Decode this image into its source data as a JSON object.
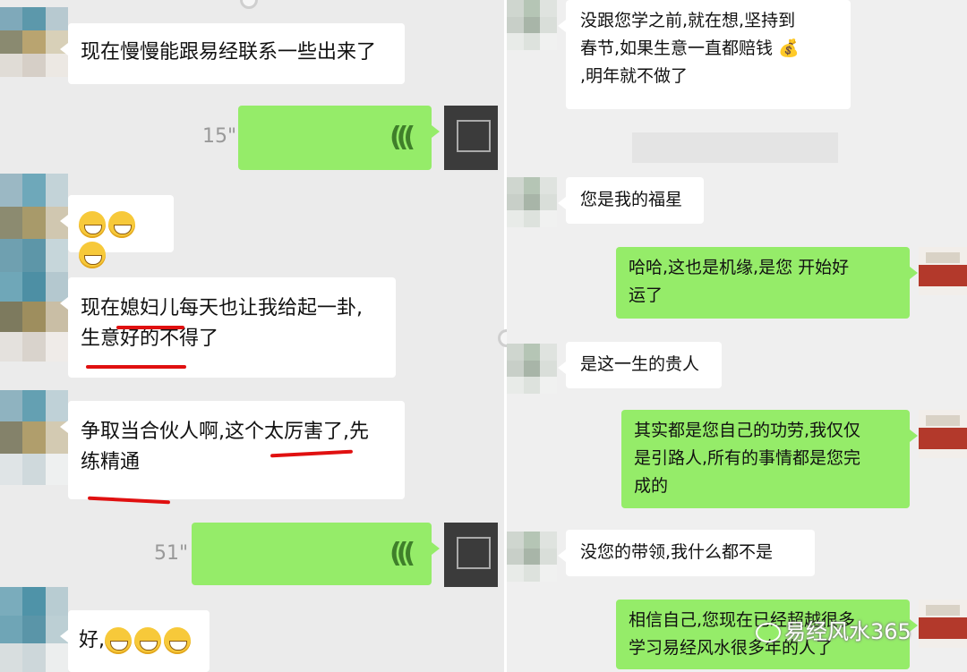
{
  "left": {
    "messages": [
      {
        "type": "text",
        "side": "in",
        "text": "现在慢慢能跟易经联系一些出来了"
      },
      {
        "type": "voice",
        "side": "out",
        "duration": "15\""
      },
      {
        "type": "emoji",
        "side": "in",
        "count": 3
      },
      {
        "type": "text",
        "side": "in",
        "line1": "现在媳妇儿每天也让我给起一卦,",
        "line2": "生意好的不得了"
      },
      {
        "type": "text",
        "side": "in",
        "line1": "争取当合伙人啊,这个太厉害了,先",
        "line2": "练精通"
      },
      {
        "type": "voice",
        "side": "out",
        "duration": "51\""
      },
      {
        "type": "emoji",
        "side": "in",
        "prefix": "好,",
        "count": 3
      }
    ],
    "voice_icon": "voice-wave-icon",
    "annotation_color": "#e01010"
  },
  "right": {
    "messages": [
      {
        "side": "in",
        "line1": "没跟您学之前,就在想,坚持到",
        "line2": "春节,如果生意一直都赔钱 💰",
        "line3": ",明年就不做了"
      },
      {
        "side": "in",
        "text": "您是我的福星"
      },
      {
        "side": "out",
        "line1": "哈哈,这也是机缘,是您 开始好",
        "line2": "运了"
      },
      {
        "side": "in",
        "text": "是这一生的贵人"
      },
      {
        "side": "out",
        "line1": "其实都是您自己的功劳,我仅仅",
        "line2": "是引路人,所有的事情都是您完",
        "line3": "成的"
      },
      {
        "side": "in",
        "text": "没您的带领,我什么都不是"
      },
      {
        "side": "out",
        "line1": "相信自己,您现在已经超越很多",
        "line2": "学习易经风水很多年的人了"
      }
    ]
  },
  "watermark": "易经风水365",
  "colors": {
    "outgoing": "#95ec69",
    "incoming": "#ffffff",
    "background": "#ebebeb"
  }
}
